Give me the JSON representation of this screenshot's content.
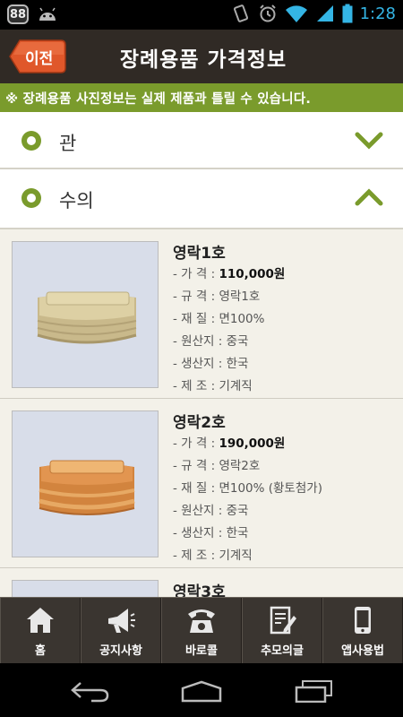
{
  "status": {
    "badge": "88",
    "time": "1:28"
  },
  "header": {
    "back_label": "이전",
    "title": "장례용품 가격정보"
  },
  "notice": "※ 장례용품 사진정보는 실제 제품과 틀릴 수 있습니다.",
  "sections": [
    {
      "label": "관",
      "expanded": false
    },
    {
      "label": "수의",
      "expanded": true
    }
  ],
  "products": [
    {
      "name": "영락1호",
      "specs": [
        {
          "label": "- 가 격 : ",
          "value": "110,000원",
          "bold": true
        },
        {
          "label": "- 규 격 : ",
          "value": "영락1호"
        },
        {
          "label": "- 재 질 : ",
          "value": "면100%"
        },
        {
          "label": "- 원산지 : ",
          "value": "중국"
        },
        {
          "label": "- 생산지 : ",
          "value": "한국"
        },
        {
          "label": "- 제 조 : ",
          "value": "기계직"
        }
      ]
    },
    {
      "name": "영락2호",
      "specs": [
        {
          "label": "- 가 격 : ",
          "value": "190,000원",
          "bold": true
        },
        {
          "label": "- 규 격 : ",
          "value": "영락2호"
        },
        {
          "label": "- 재 질 : ",
          "value": "면100% (황토첨가)"
        },
        {
          "label": "- 원산지 : ",
          "value": "중국"
        },
        {
          "label": "- 생산지 : ",
          "value": "한국"
        },
        {
          "label": "- 제 조 : ",
          "value": "기계직"
        }
      ]
    },
    {
      "name": "영락3호",
      "specs": []
    }
  ],
  "tabs": [
    {
      "label": "홈",
      "icon": "home-icon"
    },
    {
      "label": "공지사항",
      "icon": "megaphone-icon"
    },
    {
      "label": "바로콜",
      "icon": "phone-icon"
    },
    {
      "label": "추모의글",
      "icon": "memo-icon"
    },
    {
      "label": "앱사용법",
      "icon": "smartphone-icon"
    }
  ],
  "colors": {
    "accent": "#7a9b2c",
    "header": "#302a25",
    "back_button": "#e0572a",
    "clock": "#34b5e5"
  }
}
